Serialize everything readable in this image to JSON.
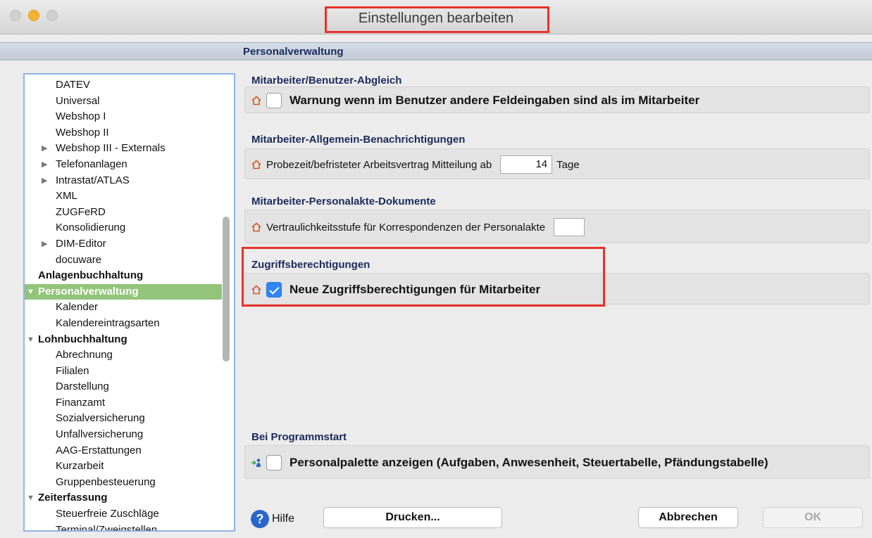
{
  "window": {
    "title": "Einstellungen bearbeiten",
    "section_title": "Personalverwaltung"
  },
  "tree": {
    "items": [
      {
        "label": "DATEV",
        "level": 1,
        "expander": ""
      },
      {
        "label": "Universal",
        "level": 1,
        "expander": ""
      },
      {
        "label": "Webshop I",
        "level": 1,
        "expander": ""
      },
      {
        "label": "Webshop II",
        "level": 1,
        "expander": ""
      },
      {
        "label": "Webshop III - Externals",
        "level": 1,
        "expander": "▶"
      },
      {
        "label": "Telefonanlagen",
        "level": 1,
        "expander": "▶"
      },
      {
        "label": "Intrastat/ATLAS",
        "level": 1,
        "expander": "▶"
      },
      {
        "label": "XML",
        "level": 1,
        "expander": ""
      },
      {
        "label": "ZUGFeRD",
        "level": 1,
        "expander": ""
      },
      {
        "label": "Konsolidierung",
        "level": 1,
        "expander": ""
      },
      {
        "label": "DIM-Editor",
        "level": 1,
        "expander": "▶"
      },
      {
        "label": "docuware",
        "level": 1,
        "expander": ""
      },
      {
        "label": "Anlagenbuchhaltung",
        "level": 0,
        "expander": ""
      },
      {
        "label": "Personalverwaltung",
        "level": 0,
        "expander": "▼",
        "selected": true
      },
      {
        "label": "Kalender",
        "level": 1,
        "expander": ""
      },
      {
        "label": "Kalendereintragsarten",
        "level": 1,
        "expander": ""
      },
      {
        "label": "Lohnbuchhaltung",
        "level": 0,
        "expander": "▼"
      },
      {
        "label": "Abrechnung",
        "level": 1,
        "expander": ""
      },
      {
        "label": "Filialen",
        "level": 1,
        "expander": ""
      },
      {
        "label": "Darstellung",
        "level": 1,
        "expander": ""
      },
      {
        "label": "Finanzamt",
        "level": 1,
        "expander": ""
      },
      {
        "label": "Sozialversicherung",
        "level": 1,
        "expander": ""
      },
      {
        "label": "Unfallversicherung",
        "level": 1,
        "expander": ""
      },
      {
        "label": "AAG-Erstattungen",
        "level": 1,
        "expander": ""
      },
      {
        "label": "Kurzarbeit",
        "level": 1,
        "expander": ""
      },
      {
        "label": "Gruppenbesteuerung",
        "level": 1,
        "expander": ""
      },
      {
        "label": "Zeiterfassung",
        "level": 0,
        "expander": "▼"
      },
      {
        "label": "Steuerfreie Zuschläge",
        "level": 1,
        "expander": ""
      },
      {
        "label": "Terminal/Zweigstellen",
        "level": 1,
        "expander": ""
      }
    ]
  },
  "groups": {
    "abgleich": {
      "title": "Mitarbeiter/Benutzer-Abgleich",
      "label": "Warnung wenn im Benutzer andere Feldeingaben sind als im Mitarbeiter",
      "checked": false
    },
    "benachrichtigungen": {
      "title": "Mitarbeiter-Allgemein-Benachrichtigungen",
      "label": "Probezeit/befristeter Arbeitsvertrag Mitteilung ab",
      "value": "14",
      "unit": "Tage"
    },
    "dokumente": {
      "title": "Mitarbeiter-Personalakte-Dokumente",
      "label": "Vertraulichkeitsstufe für Korrespondenzen der Personalakte",
      "value": ""
    },
    "zugriff": {
      "title": "Zugriffsberechtigungen",
      "label": "Neue Zugriffsberechtigungen für Mitarbeiter",
      "checked": true
    },
    "programmstart": {
      "title": "Bei Programmstart",
      "label": "Personalpalette anzeigen (Aufgaben, Anwesenheit, Steuertabelle, Pfändungstabelle)",
      "checked": false
    }
  },
  "footer": {
    "help_label": "Hilfe",
    "print_label": "Drucken...",
    "cancel_label": "Abbrechen",
    "ok_label": "OK"
  },
  "colors": {
    "selection": "#92c47a",
    "highlight_box": "#e8312a",
    "accent": "#2f86f6"
  }
}
